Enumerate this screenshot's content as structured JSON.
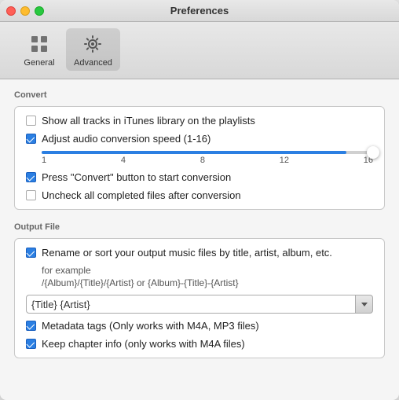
{
  "window": {
    "title": "Preferences"
  },
  "toolbar": {
    "items": [
      {
        "id": "general",
        "label": "General",
        "active": false
      },
      {
        "id": "advanced",
        "label": "Advanced",
        "active": true
      }
    ]
  },
  "convert_section": {
    "header": "Convert",
    "checkboxes": [
      {
        "id": "show-tracks",
        "label": "Show all tracks in iTunes library on the playlists",
        "checked": false
      },
      {
        "id": "adjust-speed",
        "label": "Adjust audio conversion speed (1-16)",
        "checked": true
      }
    ],
    "slider": {
      "min": "1",
      "marks": [
        "1",
        "4",
        "8",
        "12",
        "16"
      ],
      "value": 16,
      "fill_percent": 100
    },
    "more_checkboxes": [
      {
        "id": "press-convert",
        "label": "Press \"Convert\" button to start conversion",
        "checked": true
      },
      {
        "id": "uncheck-completed",
        "label": "Uncheck all completed files after conversion",
        "checked": false
      }
    ]
  },
  "output_section": {
    "header": "Output File",
    "rename_label": "Rename or sort your output music files by title, artist, album, etc.",
    "example_label": "for example",
    "example_path": "/{Album}/{Title}/{Artist} or {Album}-{Title}-{Artist}",
    "input_value": "{Title} {Artist}",
    "checkboxes": [
      {
        "id": "metadata-tags",
        "label": "Metadata tags (Only works with M4A, MP3 files)",
        "checked": true
      },
      {
        "id": "keep-chapter",
        "label": "Keep chapter info (only works with  M4A files)",
        "checked": true
      }
    ]
  },
  "icons": {
    "general": "⚙",
    "advanced": "⚙"
  }
}
